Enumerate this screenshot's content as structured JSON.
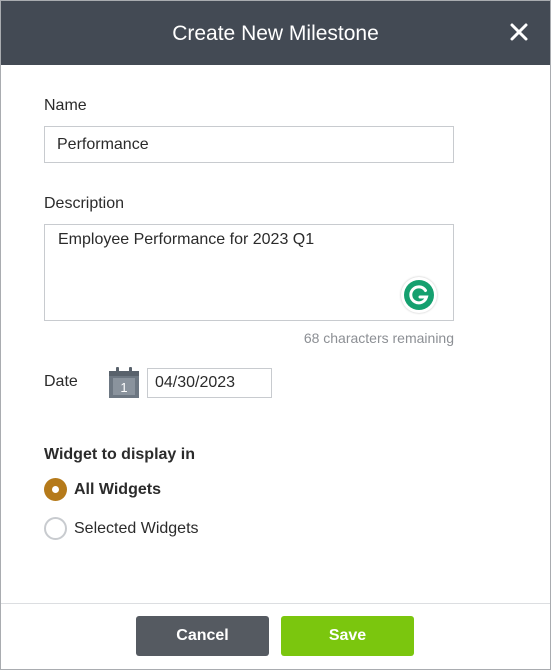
{
  "dialog": {
    "title": "Create New Milestone",
    "close_icon": "close-icon"
  },
  "form": {
    "name_label": "Name",
    "name_value": "Performance",
    "description_label": "Description",
    "description_value": "Employee Performance for 2023 Q1",
    "chars_remaining": "68 characters remaining",
    "grammarly_icon": "grammarly-icon",
    "date_label": "Date",
    "calendar_icon": "calendar-icon",
    "calendar_day": "1",
    "date_value": "04/30/2023",
    "widget_heading": "Widget to display in",
    "widget_options": [
      {
        "label": "All Widgets",
        "selected": true
      },
      {
        "label": "Selected Widgets",
        "selected": false
      }
    ]
  },
  "footer": {
    "cancel_label": "Cancel",
    "save_label": "Save"
  },
  "colors": {
    "header_bg": "#434a54",
    "accent_radio": "#b57a1a",
    "save_bg": "#7bc60e",
    "cancel_bg": "#555a61",
    "grammarly_green": "#15a06f"
  }
}
